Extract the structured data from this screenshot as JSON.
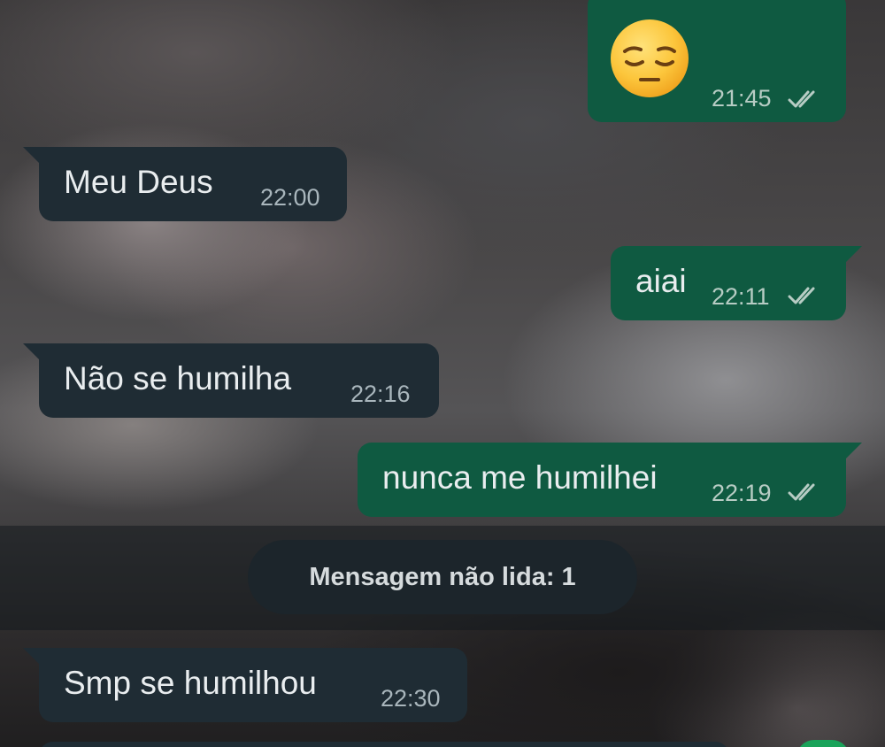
{
  "messages": [
    {
      "direction": "outgoing",
      "emoji": "pensive-face-emoji",
      "time": "21:45",
      "status": "read"
    },
    {
      "direction": "incoming",
      "text": "Meu Deus",
      "time": "22:00"
    },
    {
      "direction": "outgoing",
      "text": "aiai",
      "time": "22:11",
      "status": "read"
    },
    {
      "direction": "incoming",
      "text": "Não se humilha",
      "time": "22:16"
    },
    {
      "direction": "outgoing",
      "text": "nunca me humilhei",
      "time": "22:19",
      "status": "read"
    },
    {
      "direction": "incoming",
      "text": "Smp se humilhou",
      "time": "22:30"
    }
  ],
  "unread_divider": {
    "label": "Mensagem não lida: 1"
  },
  "colors": {
    "incoming_bubble": "#1f2c34",
    "outgoing_bubble": "#0f5a41",
    "read_ticks": "#b7ccc4",
    "unread_pill": "#1c252b"
  },
  "icons": {
    "read_status": "double-check-icon"
  }
}
